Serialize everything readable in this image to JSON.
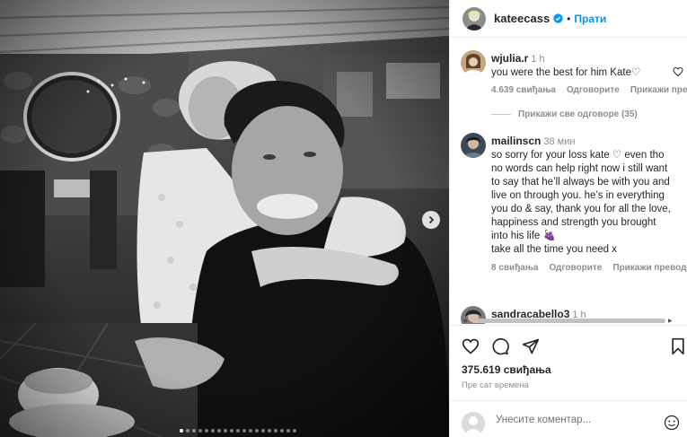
{
  "post": {
    "username": "kateecass",
    "separator": "•",
    "follow_label": "Прати"
  },
  "comments": [
    {
      "username": "wjulia.r",
      "time": "1 h",
      "text": "you were the best for him Kate♡",
      "likes": "4.639 свиђања",
      "reply": "Одговорите",
      "translate": "Прикажи превод"
    },
    {
      "username": "mailinscn",
      "time": "38 мин",
      "text": "so sorry for your loss kate ♡ even tho no words can help right now i still want to say that he’ll always be with you and live on through you. he’s in everything you do & say, thank you for all the love, happiness and strength you brought into his life 🍇\ntake all the time you need x",
      "likes": "8 свиђања",
      "reply": "Одговорите",
      "translate": "Прикажи превод"
    },
    {
      "username": "sandracabello3",
      "time": "1 h"
    }
  ],
  "view_replies": "Прикажи све одговоре (35)",
  "likes_total": "375.619 свиђања",
  "posted_ago": "Пре сат времена",
  "comment_input": {
    "placeholder": "Унесите коментар..."
  },
  "icons": {
    "verified": "verified-badge-icon",
    "like": "heart-outline-icon",
    "comment": "comment-bubble-icon",
    "share": "paper-plane-icon",
    "save": "bookmark-icon",
    "emoji": "smiley-icon",
    "next": "chevron-right-icon"
  },
  "colors": {
    "link_blue": "#0095f6",
    "verified_blue": "#0095f6",
    "muted_text": "#8e8e8e",
    "text": "#262626"
  },
  "carousel": {
    "total_slides": 19,
    "active_slide": 1
  }
}
